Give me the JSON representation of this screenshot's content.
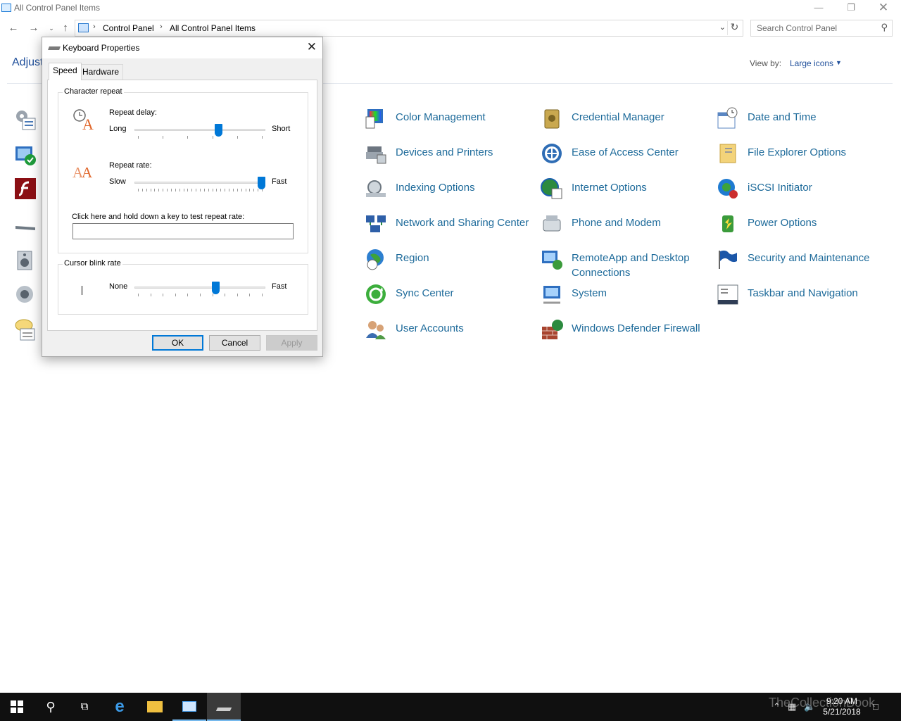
{
  "window": {
    "title": "All Control Panel Items"
  },
  "breadcrumb": [
    "Control Panel",
    "All Control Panel Items"
  ],
  "search": {
    "placeholder": "Search Control Panel"
  },
  "heading": "Adjust",
  "view_by": {
    "label": "View by:",
    "value": "Large icons"
  },
  "items": [
    {
      "label": "Color Management",
      "icon": "color-management-icon"
    },
    {
      "label": "Credential Manager",
      "icon": "credential-manager-icon"
    },
    {
      "label": "Date and Time",
      "icon": "date-time-icon"
    },
    {
      "label": "Devices and Printers",
      "icon": "printer-icon"
    },
    {
      "label": "Ease of Access Center",
      "icon": "ease-of-access-icon"
    },
    {
      "label": "File Explorer Options",
      "icon": "folder-options-icon"
    },
    {
      "label": "Indexing Options",
      "icon": "indexing-icon"
    },
    {
      "label": "Internet Options",
      "icon": "internet-options-icon"
    },
    {
      "label": "iSCSI Initiator",
      "icon": "iscsi-icon"
    },
    {
      "label": "Network and Sharing Center",
      "icon": "network-icon"
    },
    {
      "label": "Phone and Modem",
      "icon": "phone-modem-icon"
    },
    {
      "label": "Power Options",
      "icon": "power-icon"
    },
    {
      "label": "Region",
      "icon": "region-icon"
    },
    {
      "label": "RemoteApp and Desktop Connections",
      "icon": "remoteapp-icon"
    },
    {
      "label": "Security and Maintenance",
      "icon": "flag-icon"
    },
    {
      "label": "Sync Center",
      "icon": "sync-icon"
    },
    {
      "label": "System",
      "icon": "system-icon"
    },
    {
      "label": "Taskbar and Navigation",
      "icon": "taskbar-icon"
    },
    {
      "label": "User Accounts",
      "icon": "users-icon"
    },
    {
      "label": "Windows Defender Firewall",
      "icon": "firewall-icon"
    }
  ],
  "dialog": {
    "title": "Keyboard Properties",
    "tabs": [
      "Speed",
      "Hardware"
    ],
    "active_tab": "Speed",
    "character_repeat": {
      "group_label": "Character repeat",
      "repeat_delay": {
        "label": "Repeat delay:",
        "min_label": "Long",
        "max_label": "Short",
        "position": 0.65
      },
      "repeat_rate": {
        "label": "Repeat rate:",
        "min_label": "Slow",
        "max_label": "Fast",
        "position": 1.0
      },
      "test_label": "Click here and hold down a key to test repeat rate:",
      "test_value": ""
    },
    "cursor_blink": {
      "group_label": "Cursor blink rate",
      "min_label": "None",
      "max_label": "Fast",
      "position": 0.63
    },
    "buttons": {
      "ok": "OK",
      "cancel": "Cancel",
      "apply": "Apply"
    }
  },
  "taskbar": {
    "time": "9:20 AM",
    "date": "5/21/2018",
    "watermark": "TheCollectionBook"
  }
}
